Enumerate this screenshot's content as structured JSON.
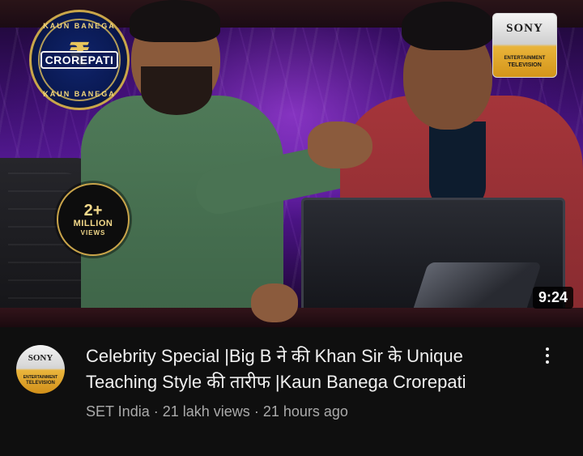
{
  "thumbnail": {
    "kbc_logo": {
      "main": "CROREPATI",
      "ring_top": "KAUN BANEGA",
      "ring_bottom": "KAUN BANEGA",
      "symbol": "₹"
    },
    "sony_logo": {
      "word": "SONY",
      "sub": "ENTERTAINMENT",
      "tv": "TELEVISION"
    },
    "views_badge": {
      "number": "2+",
      "unit": "MILLION",
      "label": "VIEWS"
    },
    "duration": "9:24"
  },
  "video": {
    "title": "Celebrity Special |Big B ने की Khan Sir के Unique Teaching Style की तारीफ |Kaun Banega Crorepati",
    "channel": "SET India",
    "views": "21 lakh views",
    "age": "21 hours ago",
    "separator": "·"
  },
  "channel_avatar": {
    "word": "SONY",
    "sub": "ENTERTAINMENT",
    "tv": "TELEVISION"
  },
  "icons": {
    "more": "more-vert-icon"
  },
  "colors": {
    "background": "#0f0f0f",
    "title_text": "#f1f1f1",
    "secondary_text": "#aaaaaa",
    "sony_gold": "#e9b43a"
  }
}
